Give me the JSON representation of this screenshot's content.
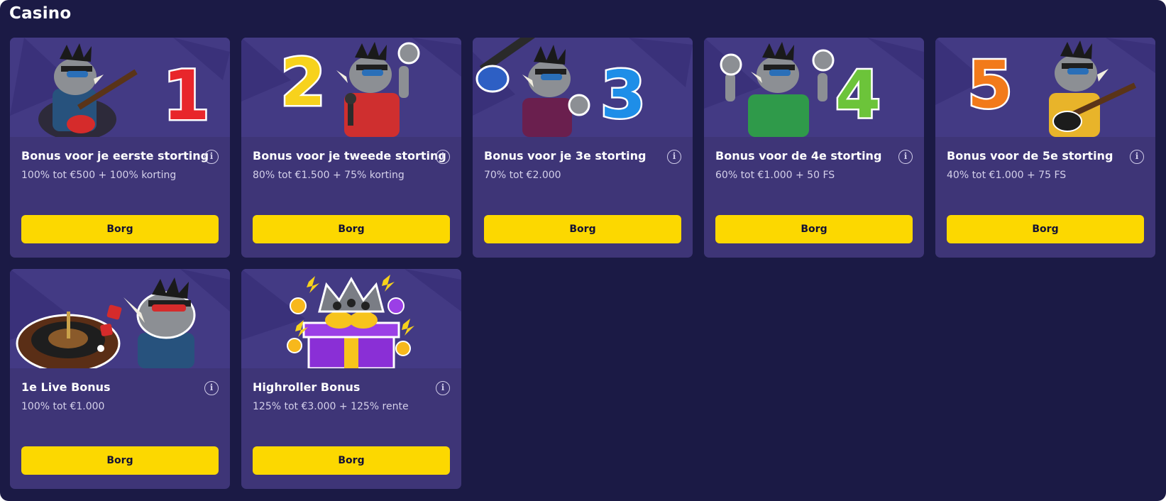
{
  "section": {
    "title": "Casino"
  },
  "colors": {
    "background": "#1b1a45",
    "card": "#3e3577",
    "banner": "#433a84",
    "button": "#fcd800",
    "button_text": "#141235"
  },
  "cards": [
    {
      "title": "Bonus voor je eerste storting",
      "subtitle": "100% tot €500 + 100% korting",
      "button": "Borg",
      "banner_number": "1",
      "banner_icon": "rhino-guitar-icon",
      "number_color": "#e8262b"
    },
    {
      "title": "Bonus voor je tweede storting",
      "subtitle": "80% tot €1.500 + 75% korting",
      "button": "Borg",
      "banner_number": "2",
      "banner_icon": "rhino-microphone-icon",
      "number_color": "#f7d21c"
    },
    {
      "title": "Bonus voor je 3e storting",
      "subtitle": "70% tot €2.000",
      "button": "Borg",
      "banner_number": "3",
      "banner_icon": "rhino-guitar-icon",
      "number_color": "#1e8ee8"
    },
    {
      "title": "Bonus voor de 4e storting",
      "subtitle": "60% tot €1.000 + 50 FS",
      "button": "Borg",
      "banner_number": "4",
      "banner_icon": "rhino-rock-hands-icon",
      "number_color": "#6cc43a"
    },
    {
      "title": "Bonus voor de 5e storting",
      "subtitle": "40% tot €1.000 + 75 FS",
      "button": "Borg",
      "banner_number": "5",
      "banner_icon": "rhino-guitar-icon",
      "number_color": "#f27a1a"
    },
    {
      "title": "1e Live Bonus",
      "subtitle": "100% tot €1.000",
      "button": "Borg",
      "banner_icon": "rhino-roulette-icon"
    },
    {
      "title": "Highroller Bonus",
      "subtitle": "125% tot €3.000 + 125% rente",
      "button": "Borg",
      "banner_icon": "gift-crown-icon"
    }
  ]
}
